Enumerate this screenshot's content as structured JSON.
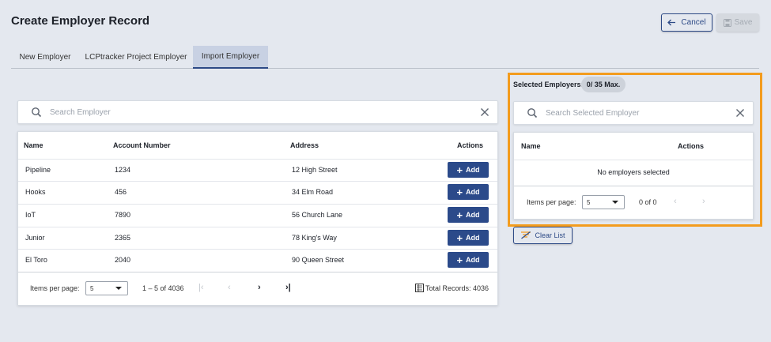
{
  "header": {
    "title": "Create Employer Record",
    "cancel_label": "Cancel",
    "save_label": "Save"
  },
  "tabs": [
    {
      "label": "New Employer",
      "active": false
    },
    {
      "label": "LCPtracker Project Employer",
      "active": false
    },
    {
      "label": "Import Employer",
      "active": true
    }
  ],
  "employer_search": {
    "placeholder": "Search Employer"
  },
  "employer_table": {
    "columns": [
      "Name",
      "Account Number",
      "Address",
      "Actions"
    ],
    "rows": [
      {
        "name": "Pipeline",
        "account": "1234",
        "address": "12 High Street",
        "action": "Add"
      },
      {
        "name": "Hooks",
        "account": "456",
        "address": "34 Elm Road",
        "action": "Add"
      },
      {
        "name": "IoT",
        "account": "7890",
        "address": "56 Church Lane",
        "action": "Add"
      },
      {
        "name": "Junior",
        "account": "2365",
        "address": "78 King's Way",
        "action": "Add"
      },
      {
        "name": "El Toro",
        "account": "2040",
        "address": "90 Queen Street",
        "action": "Add"
      }
    ],
    "pager": {
      "items_per_page_label": "Items per page:",
      "items_per_page_value": "5",
      "range": "1 – 5 of 4036",
      "total_records": "Total Records: 4036"
    }
  },
  "selected_panel": {
    "label": "Selected Employers:",
    "max_badge": "0/ 35 Max.",
    "search_placeholder": "Search Selected Employer",
    "columns": [
      "Name",
      "Actions"
    ],
    "empty_message": "No employers selected",
    "pager": {
      "items_per_page_label": "Items per page:",
      "items_per_page_value": "5",
      "range": "0 of 0"
    },
    "clear_label": "Clear List"
  },
  "colors": {
    "primary": "#2b4a8a",
    "highlight": "#f39c1e",
    "background": "#e4e8ef"
  }
}
